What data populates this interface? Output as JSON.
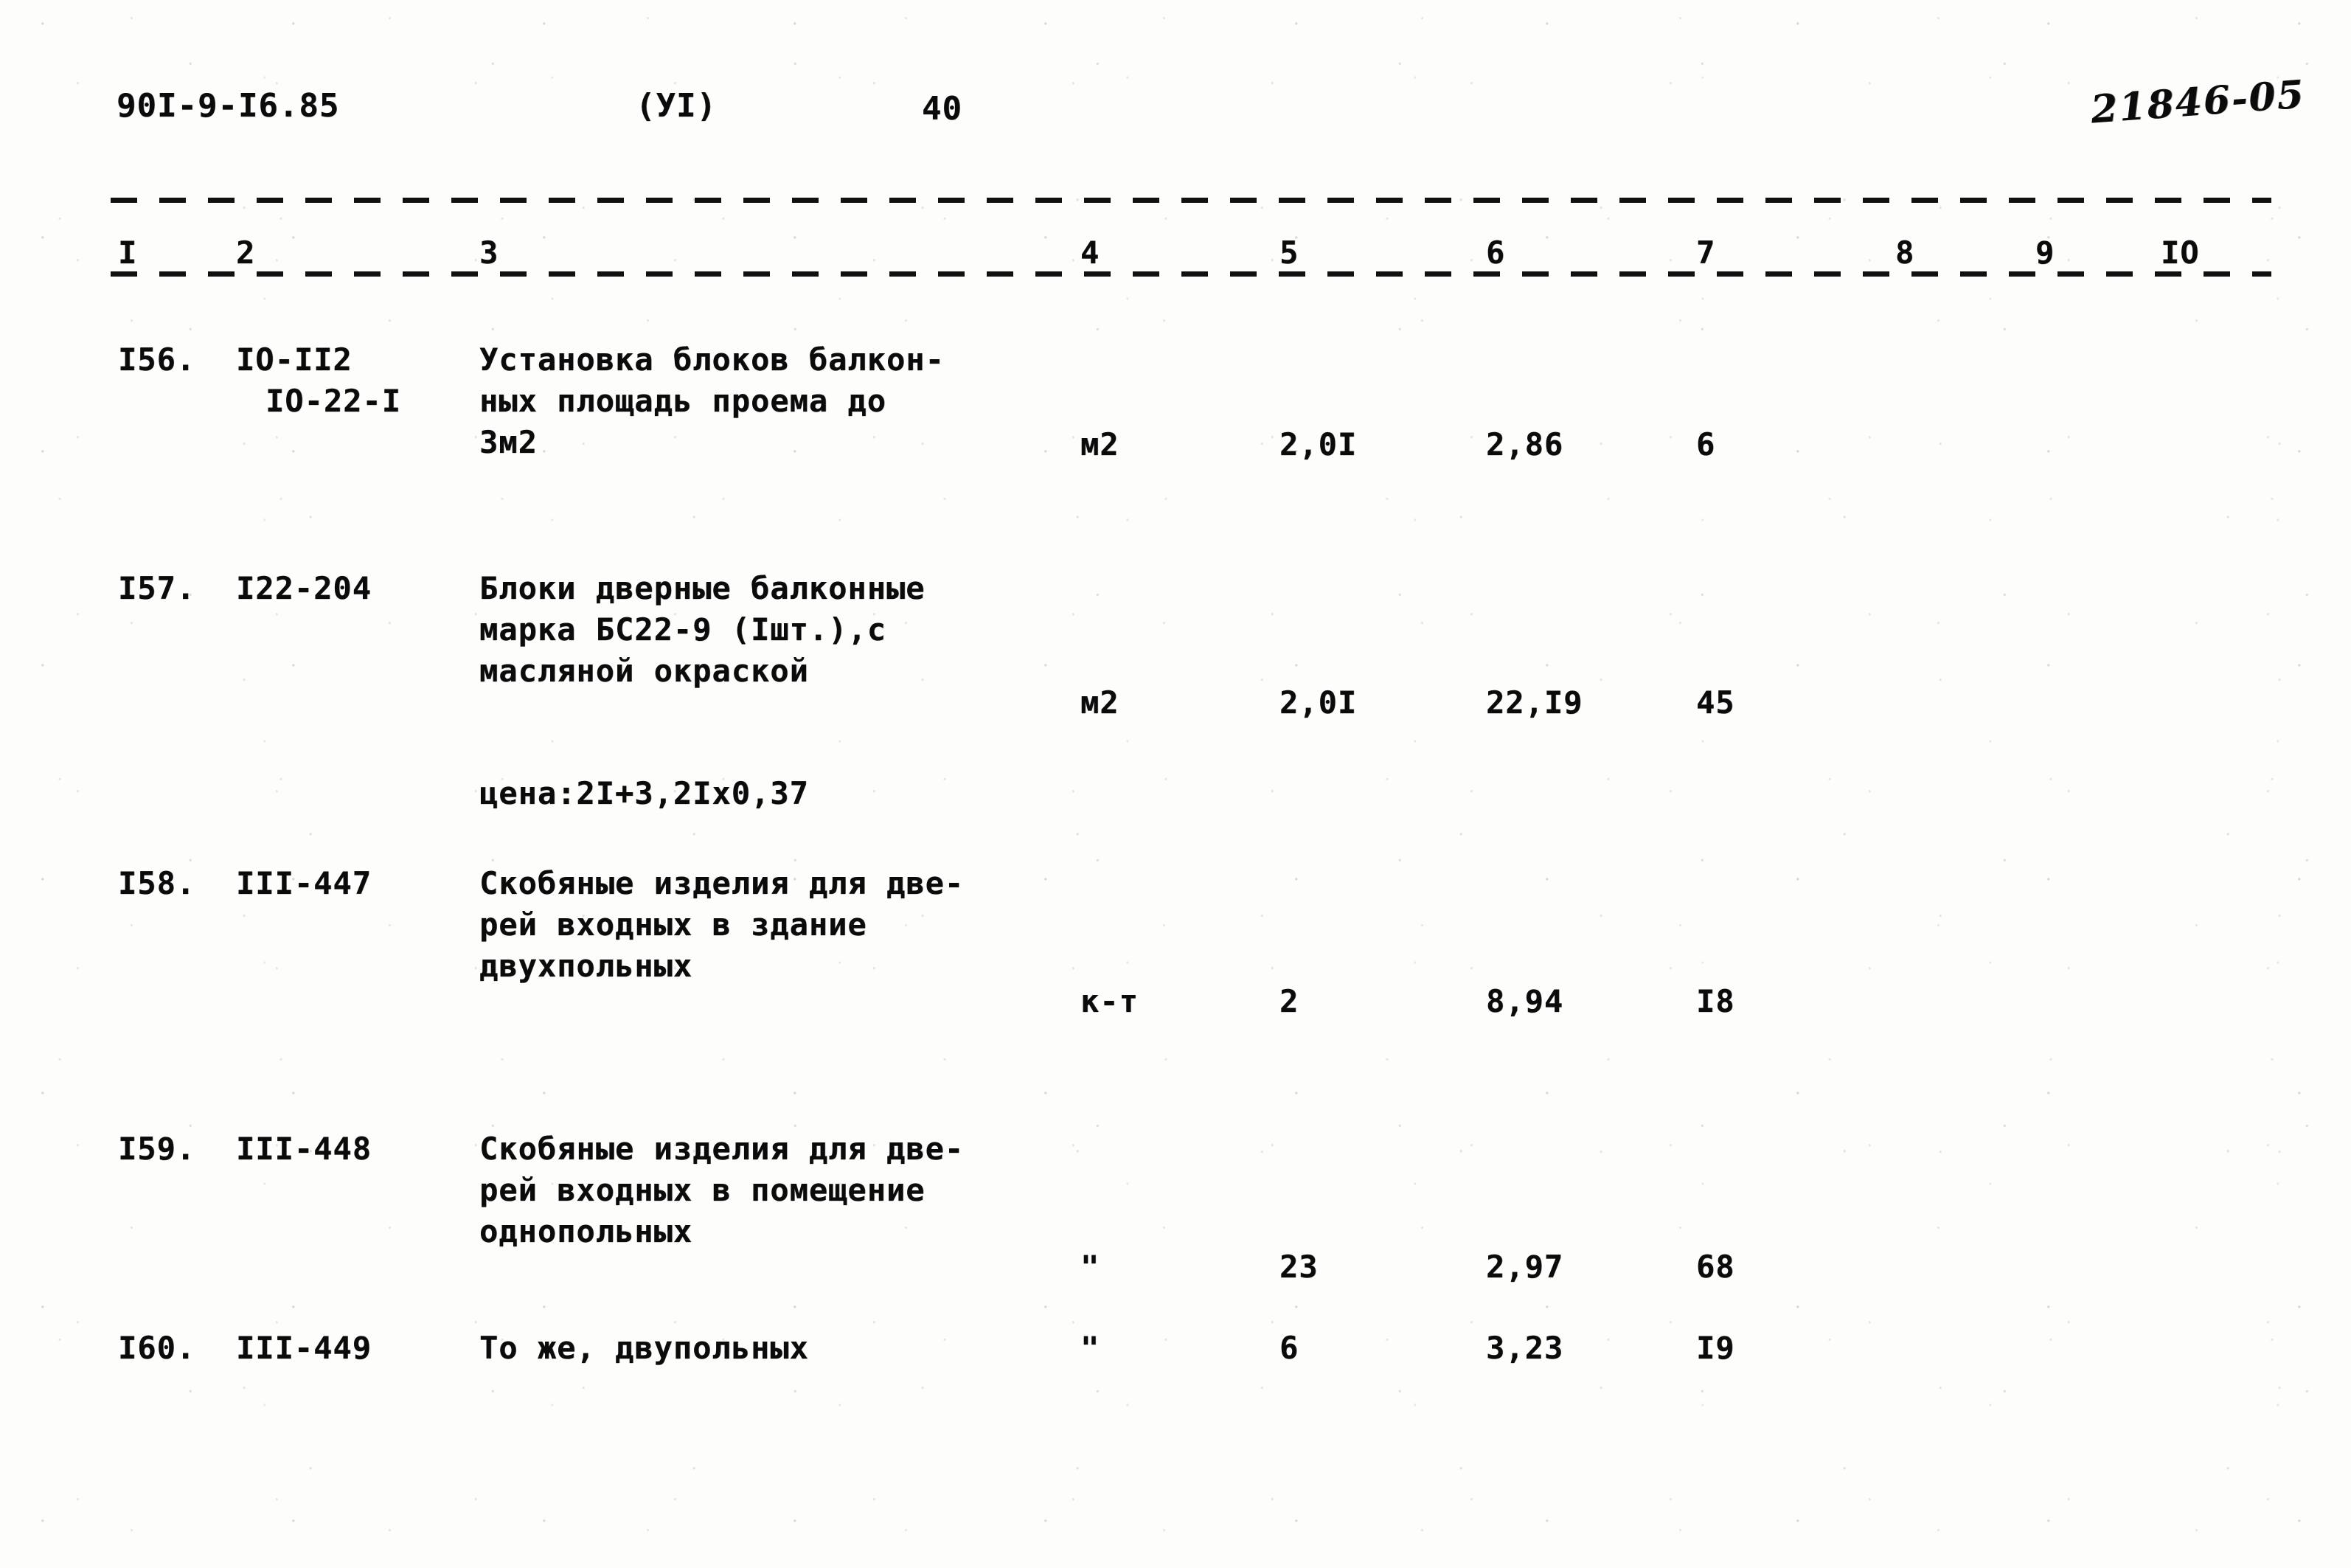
{
  "header": {
    "document_code": "90I-9-I6.85",
    "part": "(УI)",
    "page_number": "40",
    "archive_stamp": "21846-05"
  },
  "table": {
    "column_numbers": [
      "I",
      "2",
      "3",
      "4",
      "5",
      "6",
      "7",
      "8",
      "9",
      "IО"
    ],
    "rows": [
      {
        "no": "I56.",
        "code": "IО-II2",
        "code2": "IО-22-I",
        "description_lines": [
          "Установка блоков балкон-",
          "ных площадь проема до",
          "3м2"
        ],
        "unit": "м2",
        "quantity": "2,0I",
        "price": "2,86",
        "sum": "6",
        "col8": "",
        "col9": "",
        "col10": ""
      },
      {
        "no": "I57.",
        "code": "I22-204",
        "code2": "",
        "description_lines": [
          "Блоки дверные балконные",
          "марка БС22-9 (Iшт.),с",
          "масляной окраской"
        ],
        "note": "цена:2I+3,2Iх0,37",
        "unit": "м2",
        "quantity": "2,0I",
        "price": "22,I9",
        "sum": "45",
        "col8": "",
        "col9": "",
        "col10": ""
      },
      {
        "no": "I58.",
        "code": "III-447",
        "code2": "",
        "description_lines": [
          "Скобяные изделия для две-",
          "рей входных в здание",
          "двухпольных"
        ],
        "unit": "к-т",
        "quantity": "2",
        "price": "8,94",
        "sum": "I8",
        "col8": "",
        "col9": "",
        "col10": ""
      },
      {
        "no": "I59.",
        "code": "III-448",
        "code2": "",
        "description_lines": [
          "Скобяные изделия для две-",
          "рей входных в помещение",
          "однопольных"
        ],
        "unit": "\"",
        "quantity": "23",
        "price": "2,97",
        "sum": "68",
        "col8": "",
        "col9": "",
        "col10": ""
      },
      {
        "no": "I60.",
        "code": "III-449",
        "code2": "",
        "description_lines": [
          "То же, двупольных"
        ],
        "unit": "\"",
        "quantity": "6",
        "price": "3,23",
        "sum": "I9",
        "col8": "",
        "col9": "",
        "col10": ""
      }
    ]
  }
}
